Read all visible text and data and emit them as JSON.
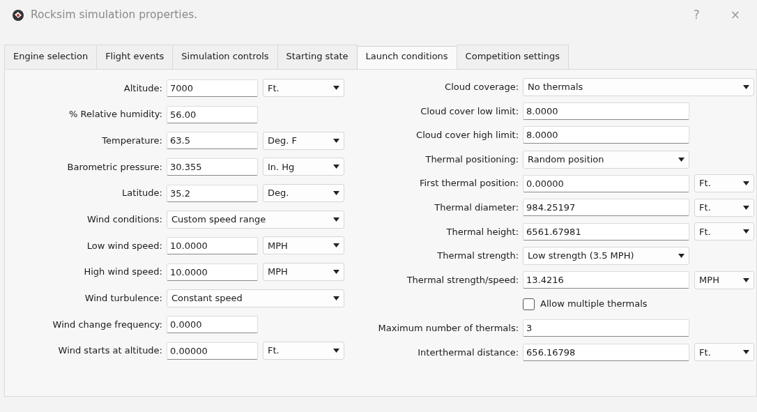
{
  "window": {
    "title": "Rocksim simulation properties.",
    "help": "?",
    "close": "×"
  },
  "tabs": [
    {
      "label": "Engine selection",
      "selected": false
    },
    {
      "label": "Flight events",
      "selected": false
    },
    {
      "label": "Simulation controls",
      "selected": false
    },
    {
      "label": "Starting state",
      "selected": false
    },
    {
      "label": "Launch conditions",
      "selected": true
    },
    {
      "label": "Competition settings",
      "selected": false
    }
  ],
  "left_fields": [
    {
      "kind": "field",
      "label": "Altitude:",
      "value": "7000",
      "unit": "Ft."
    },
    {
      "kind": "field",
      "label": "% Relative humidity:",
      "value": "56.00"
    },
    {
      "kind": "field",
      "label": "Temperature:",
      "value": "63.5",
      "unit": "Deg. F"
    },
    {
      "kind": "field",
      "label": "Barometric pressure:",
      "value": "30.355",
      "unit": "In. Hg"
    },
    {
      "kind": "field",
      "label": "Latitude:",
      "value": "35.2",
      "unit": "Deg."
    },
    {
      "kind": "dropdown",
      "label": "Wind conditions:",
      "value": "Custom speed range"
    },
    {
      "kind": "field",
      "label": "Low wind speed:",
      "value": "10.0000",
      "unit": "MPH"
    },
    {
      "kind": "field",
      "label": "High wind speed:",
      "value": "10.0000",
      "unit": "MPH"
    },
    {
      "kind": "dropdown",
      "label": "Wind turbulence:",
      "value": "Constant speed"
    },
    {
      "kind": "field",
      "label": "Wind change frequency:",
      "value": "0.0000"
    },
    {
      "kind": "field",
      "label": "Wind starts at altitude:",
      "value": "0.00000",
      "unit": "Ft."
    }
  ],
  "right_fields": [
    {
      "kind": "dropdown",
      "label": "Cloud coverage:",
      "value": "No thermals"
    },
    {
      "kind": "field",
      "label": "Cloud cover low limit:",
      "value": "8.0000"
    },
    {
      "kind": "field",
      "label": "Cloud cover high limit:",
      "value": "8.0000"
    },
    {
      "kind": "picker",
      "label": "Thermal positioning:",
      "value": "Random position"
    },
    {
      "kind": "field",
      "label": "First thermal position:",
      "value": "0.00000",
      "unit": "Ft."
    },
    {
      "kind": "field",
      "label": "Thermal diameter:",
      "value": "984.25197",
      "unit": "Ft."
    },
    {
      "kind": "field",
      "label": "Thermal height:",
      "value": "6561.67981",
      "unit": "Ft."
    },
    {
      "kind": "picker",
      "label": "Thermal strength:",
      "value": "Low strength (3.5 MPH)"
    },
    {
      "kind": "field",
      "label": "Thermal strength/speed:",
      "value": "13.4216",
      "unit": "MPH"
    },
    {
      "kind": "checkbox",
      "label": "Allow multiple thermals",
      "checked": false
    },
    {
      "kind": "field",
      "label": "Maximum number of thermals:",
      "value": "3"
    },
    {
      "kind": "field",
      "label": "Interthermal distance:",
      "value": "656.16798",
      "unit": "Ft."
    }
  ]
}
